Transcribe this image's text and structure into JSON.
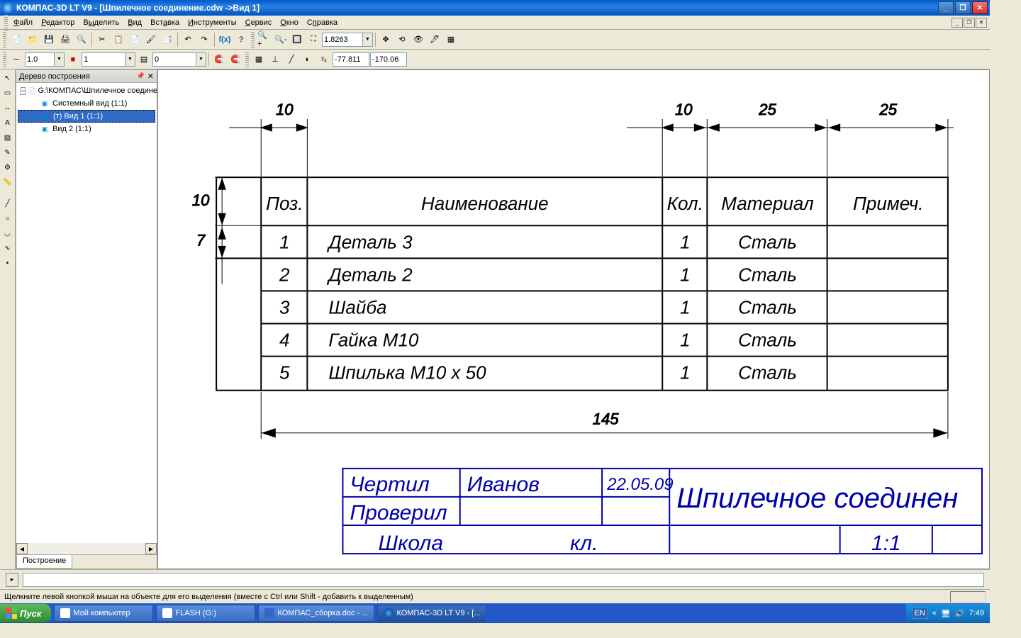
{
  "app": {
    "title": "КОМПАС-3D LT V9 - [Шпилечное соединение.cdw ->Вид 1]"
  },
  "menu": {
    "file": "Файл",
    "edit": "Редактор",
    "select": "Выделить",
    "view": "Вид",
    "insert": "Вставка",
    "tools": "Инструменты",
    "service": "Сервис",
    "window": "Окно",
    "help": "Справка"
  },
  "toolbar": {
    "zoom_value": "1.8263",
    "line_weight": "1.0",
    "num1": "1",
    "num2": "0",
    "coord_x": "-77.811",
    "coord_y": "-170.06"
  },
  "tree": {
    "title": "Дерево построения",
    "root": "G:\\КОМПАС\\Шпилечное соединен",
    "nodes": [
      {
        "label": "Системный вид (1:1)"
      },
      {
        "label": "(т) Вид 1 (1:1)",
        "selected": true
      },
      {
        "label": "Вид 2 (1:1)"
      }
    ],
    "tab": "Построение"
  },
  "drawing": {
    "dims": {
      "left_top": "10",
      "right_10": "10",
      "right_25a": "25",
      "right_25b": "25",
      "left_h10": "10",
      "left_h7": "7",
      "bottom_total": "145"
    },
    "table": {
      "headers": {
        "pos": "Поз.",
        "name": "Наименование",
        "qty": "Кол.",
        "mat": "Материал",
        "note": "Примеч."
      },
      "rows": [
        {
          "pos": "1",
          "name": "Деталь 3",
          "qty": "1",
          "mat": "Сталь",
          "note": ""
        },
        {
          "pos": "2",
          "name": "Деталь 2",
          "qty": "1",
          "mat": "Сталь",
          "note": ""
        },
        {
          "pos": "3",
          "name": "Шайба",
          "qty": "1",
          "mat": "Сталь",
          "note": ""
        },
        {
          "pos": "4",
          "name": "Гайка М10",
          "qty": "1",
          "mat": "Сталь",
          "note": ""
        },
        {
          "pos": "5",
          "name": "Шпилька М10 х 50",
          "qty": "1",
          "mat": "Сталь",
          "note": ""
        }
      ]
    },
    "stamp": {
      "drew_label": "Чертил",
      "drew_name": "Иванов",
      "date": "22.05.09",
      "checked_label": "Проверил",
      "school": "Школа",
      "class": "кл.",
      "scale": "1:1",
      "title": "Шпилечное соединен"
    }
  },
  "status": {
    "hint": "Щелкните левой кнопкой мыши на объекте для его выделения (вместе с Ctrl или Shift - добавить к выделенным)"
  },
  "taskbar": {
    "start": "Пуск",
    "tasks": [
      {
        "label": "Мой компьютер"
      },
      {
        "label": "FLASH (G:)"
      },
      {
        "label": "КОМПАС_сборка.doc - ..."
      },
      {
        "label": "КОМПАС-3D LT V9 - [..."
      }
    ],
    "tray": {
      "lang": "EN",
      "expand": "«",
      "time": "7:49"
    }
  }
}
